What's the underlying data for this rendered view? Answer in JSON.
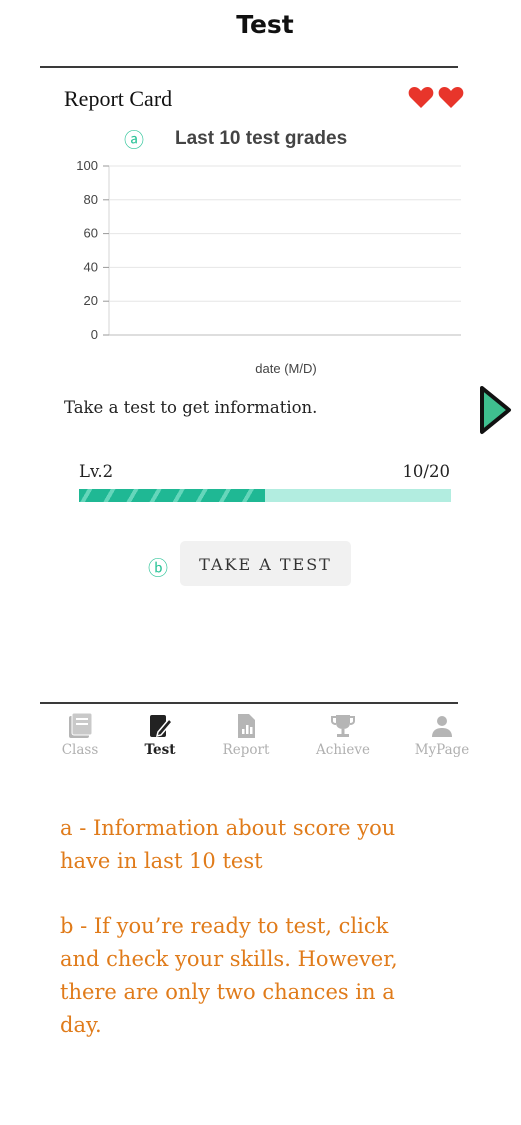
{
  "header": {
    "title": "Test"
  },
  "report_card": {
    "title": "Report Card",
    "hearts": [
      "heart-icon",
      "heart-icon"
    ],
    "heart_color": "#e8352b"
  },
  "chart": {
    "marker": "ⓐ",
    "title": "Last 10 test grades",
    "xlabel": "date (M/D)",
    "y_ticks": [
      "100",
      "80",
      "60",
      "40",
      "20",
      "0"
    ]
  },
  "chart_data": {
    "type": "line",
    "title": "Last 10 test grades",
    "xlabel": "date (M/D)",
    "ylabel": "",
    "ylim": [
      0,
      100
    ],
    "y_ticks": [
      0,
      20,
      40,
      60,
      80,
      100
    ],
    "grid": true,
    "categories": [],
    "series": []
  },
  "info": {
    "text": "Take a test to get information."
  },
  "level": {
    "label": "Lv.2",
    "count": "10/20",
    "progress": 0.5,
    "fill_color": "#1fb894",
    "track_color": "#b2ede0"
  },
  "action": {
    "marker": "ⓑ",
    "button_label": "TAKE A TEST"
  },
  "nav": {
    "items": [
      {
        "label": "Class",
        "icon": "class-icon",
        "active": false
      },
      {
        "label": "Test",
        "icon": "test-icon",
        "active": true
      },
      {
        "label": "Report",
        "icon": "report-icon",
        "active": false
      },
      {
        "label": "Achieve",
        "icon": "achieve-icon",
        "active": false
      },
      {
        "label": "MyPage",
        "icon": "mypage-icon",
        "active": false
      }
    ]
  },
  "annotations": {
    "a_line1": "a - Information about score you",
    "a_line2": "have in last 10 test",
    "b_line1": "b - If you’re ready to test, click",
    "b_line2": "and check your skills. However,",
    "b_line3": "there are only two chances in a",
    "b_line4": "day."
  },
  "colors": {
    "accent": "#2ec499",
    "annotation": "#e07b1a",
    "arrow_fill": "#3fbf8f"
  }
}
